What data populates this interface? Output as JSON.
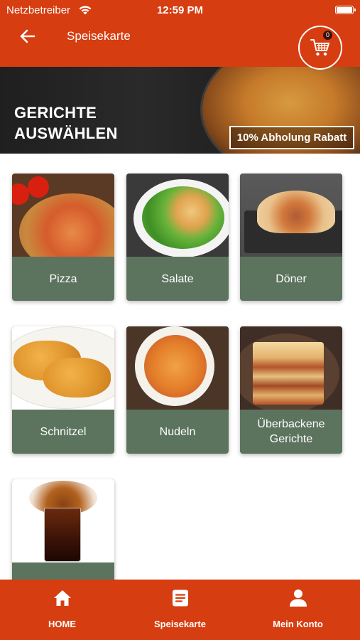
{
  "status_bar": {
    "carrier": "Netzbetreiber",
    "time": "12:59 PM"
  },
  "nav": {
    "title": "Speisekarte",
    "cart_count": "0"
  },
  "hero": {
    "title_line1": "GERICHTE",
    "title_line2": "AUSWÄHLEN",
    "badge": "10% Abholung Rabatt"
  },
  "categories": [
    {
      "label": "Pizza",
      "image": "pizza-photo"
    },
    {
      "label": "Salate",
      "image": "salad-photo"
    },
    {
      "label": "Döner",
      "image": "doner-photo"
    },
    {
      "label": "Schnitzel",
      "image": "schnitzel-photo"
    },
    {
      "label": "Nudeln",
      "image": "pasta-photo"
    },
    {
      "label": "Überbackene Gerichte",
      "image": "lasagne-photo"
    },
    {
      "label": "",
      "image": "drink-photo"
    }
  ],
  "tabs": [
    {
      "label": "HOME",
      "icon": "home-icon"
    },
    {
      "label": "Speisekarte",
      "icon": "menu-icon"
    },
    {
      "label": "Mein Konto",
      "icon": "account-icon"
    }
  ],
  "colors": {
    "brand": "#d63d10",
    "card_label_bg": "#5c745e",
    "text_light": "#ffffff"
  }
}
